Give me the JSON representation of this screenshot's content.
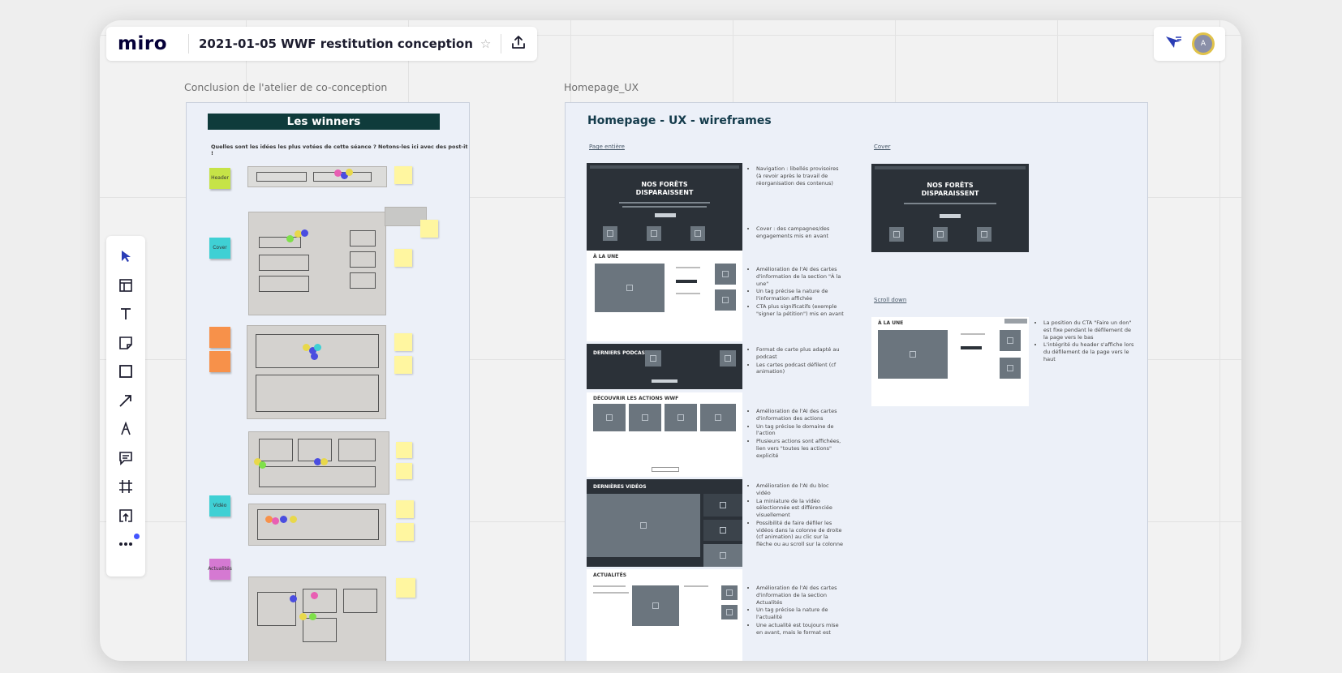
{
  "app": {
    "logo": "miro",
    "board_title": "2021-01-05 WWF restitution conception",
    "avatar_initial": "A"
  },
  "colors": {
    "accent": "#4255ff",
    "banner": "#0f3b3b",
    "wireframe_dark": "#2b3138"
  },
  "toolbar": {
    "tools": [
      {
        "name": "select-tool",
        "icon": "cursor-icon"
      },
      {
        "name": "templates-tool",
        "icon": "templates-icon"
      },
      {
        "name": "text-tool",
        "icon": "text-icon"
      },
      {
        "name": "sticky-note-tool",
        "icon": "sticky-note-icon"
      },
      {
        "name": "shape-tool",
        "icon": "square-icon"
      },
      {
        "name": "connection-line-tool",
        "icon": "arrow-icon"
      },
      {
        "name": "pen-tool",
        "icon": "pen-icon"
      },
      {
        "name": "comment-tool",
        "icon": "comment-icon"
      },
      {
        "name": "frame-tool",
        "icon": "frame-icon"
      },
      {
        "name": "upload-tool",
        "icon": "upload-icon"
      },
      {
        "name": "more-tools",
        "icon": "more-icon"
      }
    ]
  },
  "frames": {
    "left_label": "Conclusion de l'atelier de co-conception",
    "right_label": "Homepage_UX"
  },
  "winners": {
    "title": "Les winners",
    "question": "Quelles sont les idées les plus votées de cette séance ? Notons-les ici avec des post-it !",
    "stickies": [
      {
        "label": "Header",
        "color": "#c6e347"
      },
      {
        "label": "Cover",
        "color": "#3fd0d4"
      },
      {
        "label": "",
        "color": "#f7914a"
      },
      {
        "label": "",
        "color": "#f7914a"
      },
      {
        "label": "Vidéo",
        "color": "#3fd0d4"
      },
      {
        "label": "Actualités",
        "color": "#d579d2"
      }
    ],
    "notes": [
      "",
      "",
      "",
      "",
      "",
      "",
      "",
      "",
      "",
      "",
      "",
      ""
    ]
  },
  "homepage": {
    "title": "Homepage - UX - wireframes",
    "link_full": "Page entière",
    "link_cover": "Cover",
    "link_scroll": "Scroll down",
    "hero_title_line1": "NOS FORÊTS",
    "hero_title_line2": "DISPARAISSENT",
    "sec_une": "À LA UNE",
    "sec_podcast": "DERNIERS PODCAST",
    "sec_actions": "DÉCOUVRIR LES ACTIONS WWF",
    "sec_videos": "DERNIÈRES VIDÉOS",
    "sec_actus": "ACTUALITÉS",
    "notes": [
      [
        "Navigation : libellés provisoires (à revoir après le travail de réorganisation des contenus)"
      ],
      [
        "Cover : des campagnes/des engagements mis en avant"
      ],
      [
        "Amélioration de l'AI des cartes d'information de la section \"À la une\"",
        "Un tag précise la nature de l'information affichée",
        "CTA plus significatifs (exemple \"signer la pétition\") mis en avant"
      ],
      [
        "Format de carte plus adapté au podcast",
        "Les cartes podcast défilent (cf animation)"
      ],
      [
        "Amélioration de l'AI des cartes d'information des actions",
        "Un tag précise le domaine de l'action",
        "Plusieurs actions sont affichées, lien vers \"toutes les actions\" explicité"
      ],
      [
        "Amélioration de l'AI du bloc vidéo",
        "La miniature de la vidéo sélectionnée est différenciée visuellement",
        "Possibilité de faire défiler les vidéos dans la colonne de droite (cf animation) au clic sur la flèche ou au scroll sur la colonne"
      ],
      [
        "Amélioration de l'AI des cartes d'information de la section Actualités",
        "Un tag précise la nature de l'actualité",
        "Une actualité est toujours mise en avant, mais le format est"
      ]
    ],
    "scroll_notes": [
      "La position du CTA \"Faire un don\" est fixe pendant le défilement de la page vers le bas",
      "L'intégrité du header s'affiche lors du défilement de la page vers le haut"
    ]
  }
}
